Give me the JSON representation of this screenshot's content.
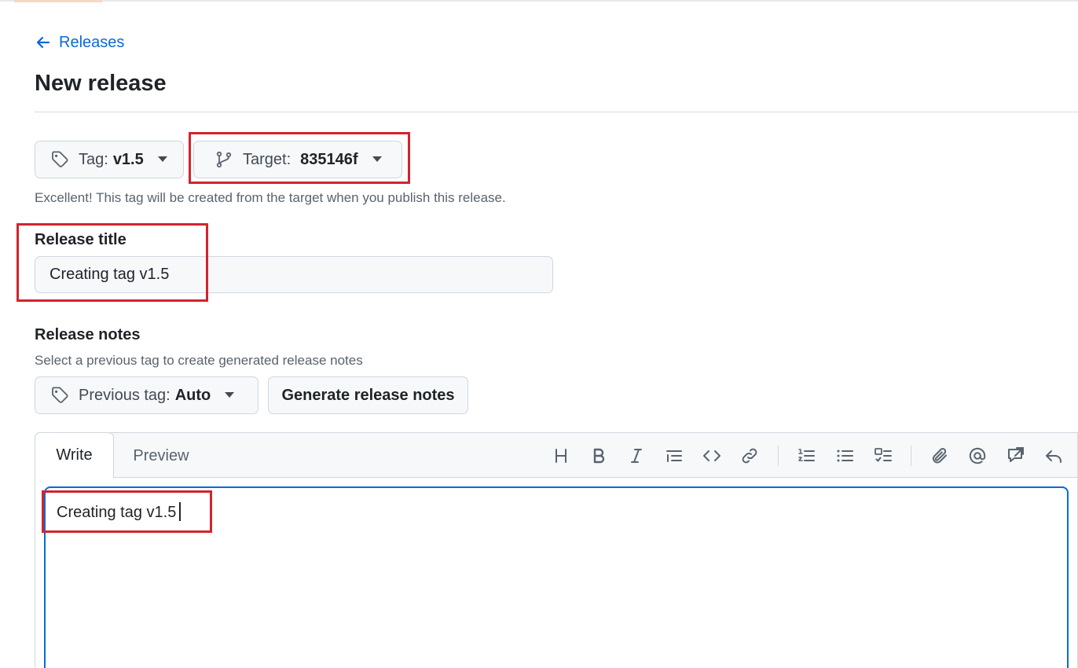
{
  "nav": {
    "back_label": "Releases"
  },
  "page": {
    "title": "New release"
  },
  "tag_picker": {
    "label": "Tag:",
    "value": "v1.5"
  },
  "target_picker": {
    "label": "Target:",
    "value": "835146f"
  },
  "tag_hint": "Excellent! This tag will be created from the target when you publish this release.",
  "release_title": {
    "label": "Release title",
    "value": "Creating tag v1.5"
  },
  "release_notes": {
    "label": "Release notes",
    "hint": "Select a previous tag to create generated release notes",
    "previous_tag_label": "Previous tag:",
    "previous_tag_value": "Auto",
    "generate_label": "Generate release notes"
  },
  "editor": {
    "tabs": [
      {
        "label": "Write",
        "active": true
      },
      {
        "label": "Preview",
        "active": false
      }
    ],
    "content": "Creating tag v1.5",
    "toolbar_icons": [
      "heading-icon",
      "bold-icon",
      "italic-icon",
      "quote-icon",
      "code-icon",
      "link-icon",
      "ordered-list-icon",
      "unordered-list-icon",
      "task-list-icon",
      "attach-icon",
      "mention-icon",
      "reference-icon",
      "undo-icon"
    ]
  },
  "colors": {
    "link": "#0969da",
    "highlight": "#d1242f",
    "focus": "#0969da"
  }
}
